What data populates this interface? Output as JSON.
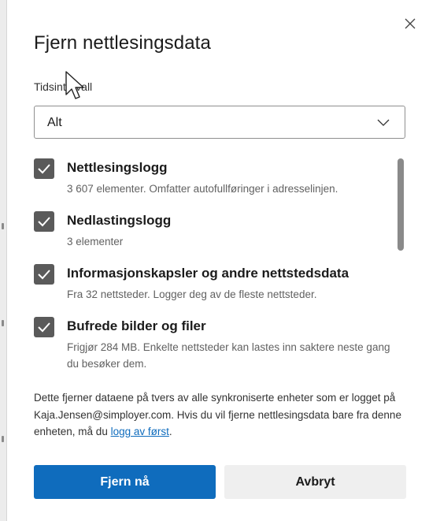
{
  "dialog": {
    "title": "Fjern nettlesingsdata",
    "close_icon": "close-icon"
  },
  "time_range": {
    "label": "Tidsintervall",
    "selected": "Alt",
    "chevron_icon": "chevron-down-icon"
  },
  "items": [
    {
      "title": "Nettlesingslogg",
      "description": "3 607 elementer. Omfatter autofullføringer i adresselinjen.",
      "checked": true
    },
    {
      "title": "Nedlastingslogg",
      "description": "3 elementer",
      "checked": true
    },
    {
      "title": "Informasjonskapsler og andre nettstedsdata",
      "description": "Fra 32 nettsteder. Logger deg av de fleste nettsteder.",
      "checked": true
    },
    {
      "title": "Bufrede bilder og filer",
      "description": "Frigjør 284 MB. Enkelte nettsteder kan lastes inn saktere neste gang du besøker dem.",
      "checked": true
    }
  ],
  "notice": {
    "text": "Dette fjerner dataene på tvers av alle synkroniserte enheter som er logget på Kaja.Jensen@simployer.com. Hvis du vil fjerne nettlesingsdata bare fra denne enheten, må du ",
    "link": "logg av først",
    "suffix": "."
  },
  "buttons": {
    "primary": "Fjern nå",
    "secondary": "Avbryt"
  },
  "colors": {
    "accent": "#0f6cbd",
    "checkbox": "#5a5a5a"
  }
}
